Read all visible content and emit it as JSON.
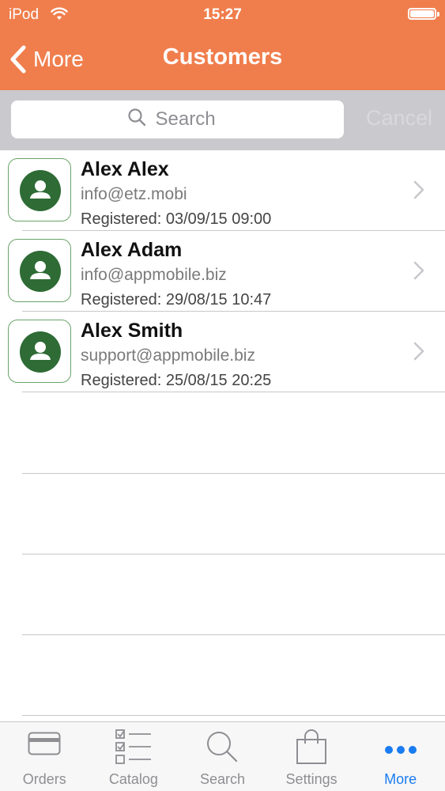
{
  "status_bar": {
    "carrier": "iPod",
    "time": "15:27"
  },
  "nav": {
    "back_label": "More",
    "title": "Customers"
  },
  "search": {
    "placeholder": "Search",
    "cancel_label": "Cancel"
  },
  "customers": [
    {
      "name": "Alex Alex",
      "email": "info@etz.mobi",
      "registered": "Registered: 03/09/15 09:00"
    },
    {
      "name": "Alex Adam",
      "email": "info@appmobile.biz",
      "registered": "Registered: 29/08/15 10:47"
    },
    {
      "name": "Alex Smith",
      "email": "support@appmobile.biz",
      "registered": "Registered: 25/08/15 20:25"
    }
  ],
  "tabs": [
    {
      "label": "Orders",
      "icon": "card-icon"
    },
    {
      "label": "Catalog",
      "icon": "checklist-icon"
    },
    {
      "label": "Search",
      "icon": "magnifier-icon"
    },
    {
      "label": "Settings",
      "icon": "bag-icon"
    },
    {
      "label": "More",
      "icon": "more-dots-icon",
      "active": true
    }
  ],
  "colors": {
    "nav_bar": "#f07e4d",
    "avatar": "#2e6b35",
    "active_tab": "#1a7cf0"
  }
}
